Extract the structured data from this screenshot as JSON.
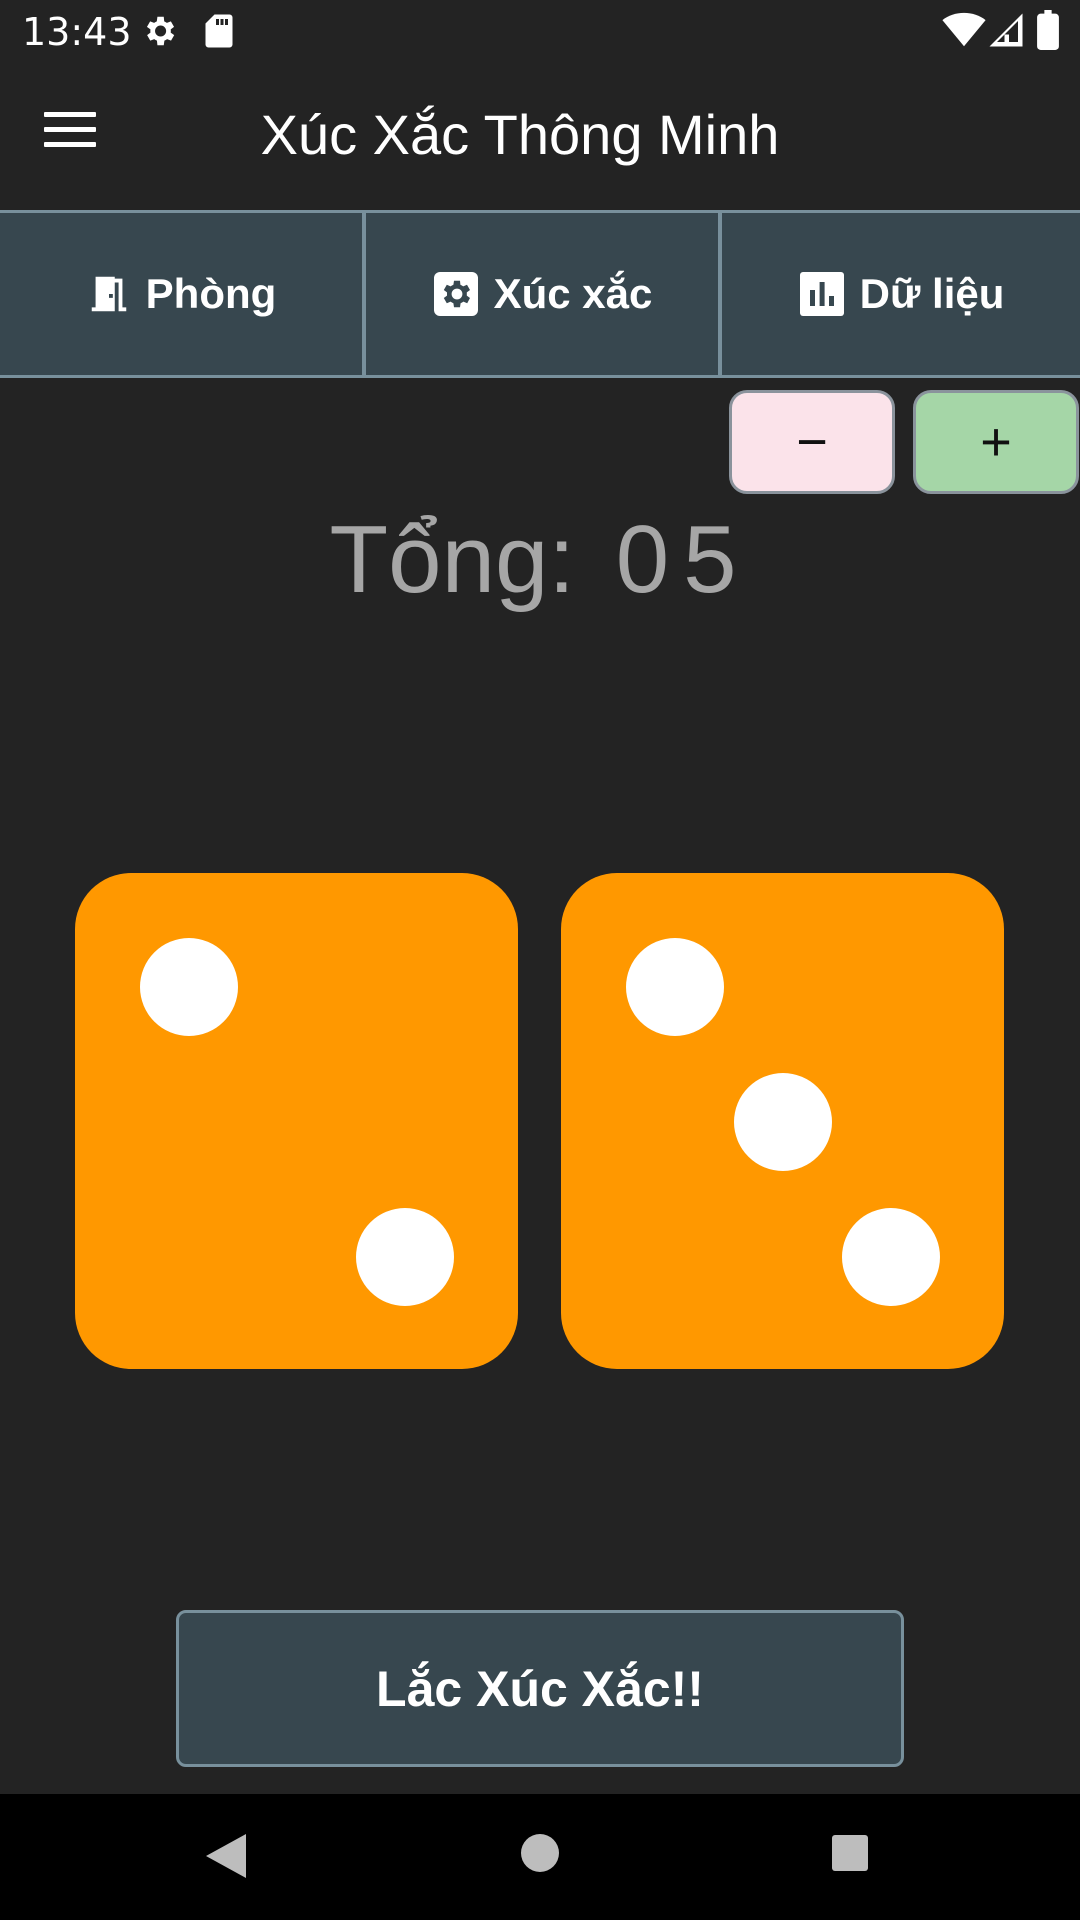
{
  "status": {
    "time": "13:43",
    "icons": [
      "gear-icon",
      "sd-card-icon",
      "wifi-icon",
      "signal-icon",
      "battery-icon"
    ]
  },
  "app_bar": {
    "title": "Xúc Xắc Thông Minh",
    "menu_icon": "menu-icon"
  },
  "tabs": [
    {
      "label": "Phòng",
      "icon": "door-icon"
    },
    {
      "label": "Xúc xắc",
      "icon": "settings-icon"
    },
    {
      "label": "Dữ liệu",
      "icon": "bar-chart-icon"
    }
  ],
  "controls": {
    "minus_label": "−",
    "plus_label": "+"
  },
  "total": {
    "label": "Tổng:",
    "value": "05"
  },
  "dice": [
    2,
    3
  ],
  "roll_button": {
    "label": "Lắc Xúc Xắc!!"
  },
  "colors": {
    "background": "#232323",
    "tab_bar": "#37474f",
    "tab_border": "#78909c",
    "die": "#ff9800",
    "minus_button": "#fbe3ea",
    "plus_button": "#a5d6a7",
    "total_text": "#a6a6a6"
  },
  "nav_bar": {
    "icons": [
      "back-icon",
      "home-icon",
      "recent-apps-icon"
    ]
  }
}
